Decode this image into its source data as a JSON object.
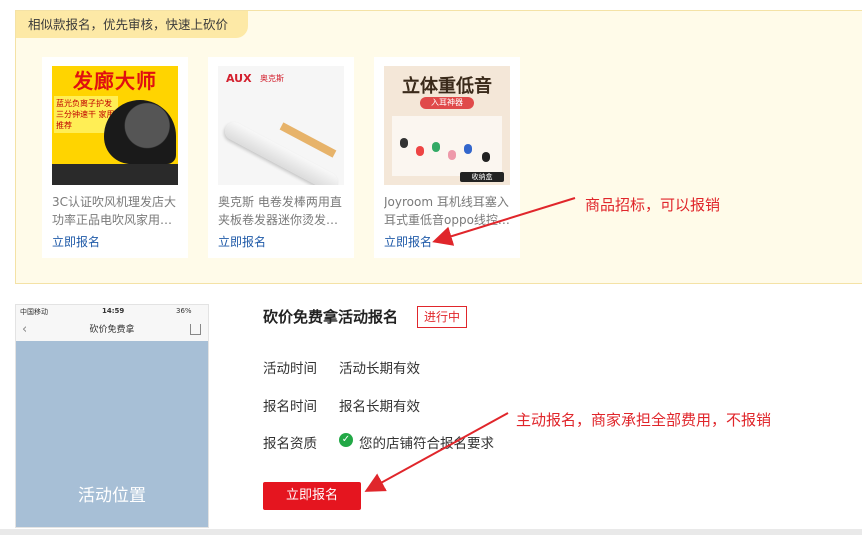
{
  "promo": {
    "tag": "相似款报名，优先审核，快速上砍价",
    "cards": [
      {
        "title": "3C认证吹风机理发店大功率正品电吹风家用…",
        "join_label": "立即报名",
        "thumb_head": "发廊大师",
        "thumb_sub": "蓝光负离子护发 三分钟速干 家用推荐"
      },
      {
        "title": "奥克斯 电卷发棒两用直夹板卷发器迷你烫发…",
        "join_label": "立即报名",
        "thumb_brand": "AUX",
        "thumb_brand_cn": "奥克斯"
      },
      {
        "title": "Joyroom 耳机线耳塞入耳式重低音oppo线控…",
        "join_label": "立即报名",
        "thumb_head": "立体重低音",
        "thumb_pill": "入耳神器",
        "thumb_foot": "收纳盒"
      }
    ]
  },
  "phone": {
    "carrier": "中国移动",
    "time": "14:59",
    "battery": "36%",
    "nav_title": "砍价免费拿",
    "area_label": "活动位置"
  },
  "activity": {
    "title": "砍价免费拿活动报名",
    "status": "进行中",
    "rows": [
      {
        "label": "活动时间",
        "value": "活动长期有效"
      },
      {
        "label": "报名时间",
        "value": "报名长期有效"
      },
      {
        "label": "报名资质",
        "value": "您的店铺符合报名要求"
      }
    ],
    "cta": "立即报名"
  },
  "annotations": {
    "top": "商品招标，可以报销",
    "bottom": "主动报名，商家承担全部费用，不报销"
  },
  "colors": {
    "accent_red": "#e5151f",
    "link_blue": "#1f5aa8",
    "promo_bg": "#fffbe9",
    "check_green": "#22a846"
  }
}
